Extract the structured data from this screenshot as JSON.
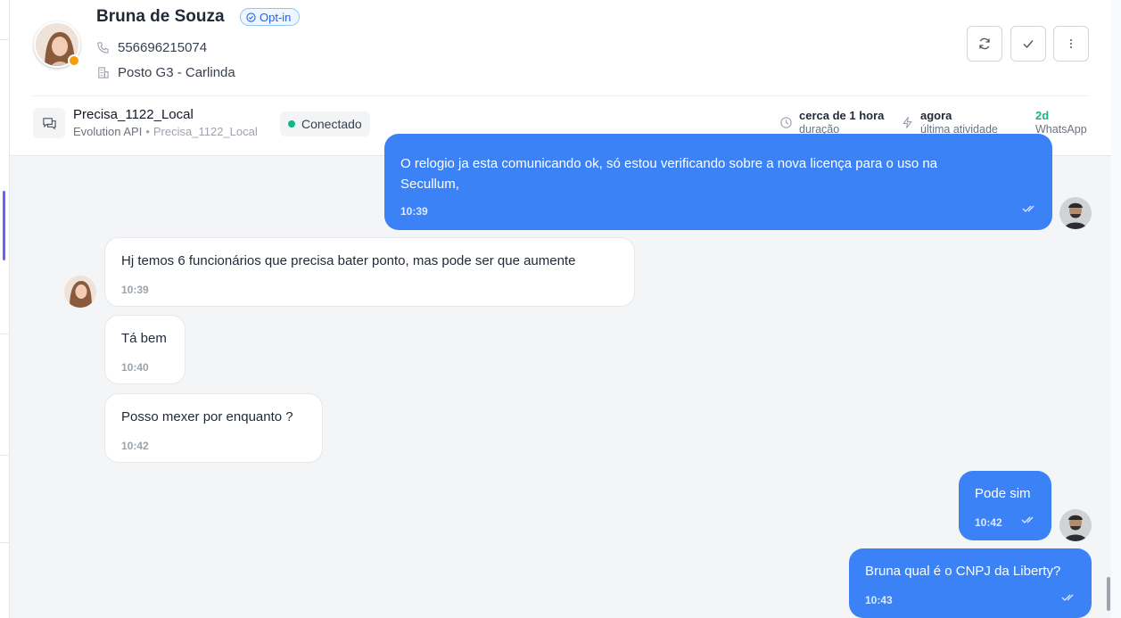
{
  "contact": {
    "name": "Bruna de Souza",
    "badge": "Opt-in",
    "phone": "556696215074",
    "location": "Posto G3 - Carlinda",
    "presence_color": "#f59e0b"
  },
  "header_actions": [
    {
      "name": "refresh",
      "icon": "refresh-icon"
    },
    {
      "name": "resolve",
      "icon": "check-icon"
    },
    {
      "name": "more",
      "icon": "more-vertical-icon"
    }
  ],
  "channel": {
    "name": "Precisa_1122_Local",
    "provider": "Evolution API",
    "instance": "Precisa_1122_Local",
    "status": "Conectado",
    "status_color": "#10b981"
  },
  "stats": {
    "duration_value": "cerca de 1 hora",
    "duration_label": "duração",
    "activity_value": "agora",
    "activity_label": "última atividade",
    "channel_value": "2d",
    "channel_label": "WhatsApp"
  },
  "messages": [
    {
      "direction": "out",
      "text_line1": "O relogio ja esta comunicando ok, só estou verificando sobre a nova licença para o uso na",
      "text_line2": "Secullum,",
      "time": "10:39"
    },
    {
      "direction": "in",
      "text": "Hj temos 6 funcionários que precisa bater ponto, mas pode ser que aumente",
      "time": "10:39"
    },
    {
      "direction": "in",
      "text": "Tá bem",
      "time": "10:40"
    },
    {
      "direction": "in",
      "text": "Posso mexer por enquanto ?",
      "time": "10:42"
    },
    {
      "direction": "out",
      "text": "Pode sim",
      "time": "10:42"
    },
    {
      "direction": "out",
      "text": "Bruna qual é o CNPJ da Liberty?",
      "time": "10:43"
    }
  ],
  "colors": {
    "outgoing_bubble": "#3b82f6",
    "incoming_bubble": "#ffffff",
    "background": "#f4f5f7",
    "accent": "#2563eb"
  }
}
